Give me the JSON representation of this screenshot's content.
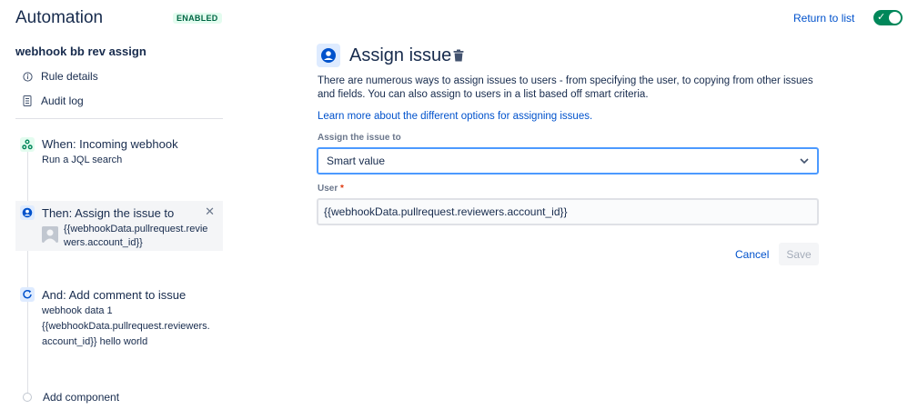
{
  "header": {
    "title": "Automation",
    "status_badge": "ENABLED",
    "return_link": "Return to list",
    "toggle_state": "on",
    "accent_color": "#00875a"
  },
  "sidebar": {
    "rule_name": "webhook bb rev assign",
    "nav": [
      {
        "label": "Rule details",
        "icon": "info-icon"
      },
      {
        "label": "Audit log",
        "icon": "document-icon"
      }
    ],
    "components": {
      "when": {
        "title": "When: Incoming webhook",
        "subtitle": "Run a JQL search",
        "icon": "webhook-icon"
      },
      "then": {
        "title": "Then: Assign the issue to",
        "line1": "{{webhookData.pullrequest.revie",
        "line2": "wers.account_id}}",
        "icon": "user-circle-icon"
      },
      "and": {
        "title": "And: Add comment to issue",
        "line1": "webhook data 1",
        "line2": "{{webhookData.pullrequest.reviewers.",
        "line3": "account_id}} hello world",
        "icon": "comment-edit-icon"
      }
    },
    "add_component": "Add component"
  },
  "main": {
    "title": "Assign issue",
    "description": "There are numerous ways to assign issues to users - from specifying the user, to copying from other issues and fields. You can also assign to users in a list based off smart criteria.",
    "learn_more": "Learn more about the different options for assigning issues.",
    "assign_label": "Assign the issue to",
    "assign_value": "Smart value",
    "user_label": "User",
    "user_required": "*",
    "user_value": "{{webhookData.pullrequest.reviewers.account_id}}",
    "cancel_label": "Cancel",
    "save_label": "Save"
  }
}
